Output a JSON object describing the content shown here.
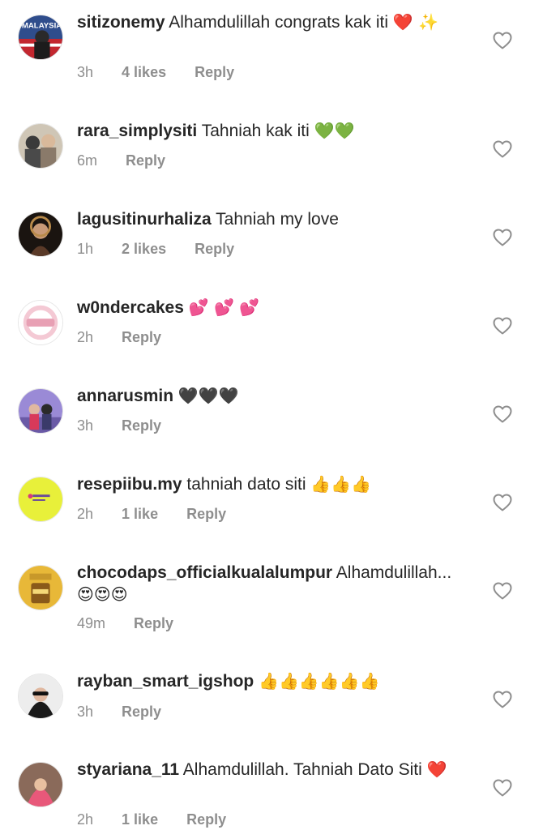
{
  "comments": [
    {
      "username": "sitizonemy",
      "text": "Alhamdulillah congrats kak iti",
      "emoji": "❤️ ✨",
      "time": "3h",
      "likes": "4 likes",
      "reply": "Reply"
    },
    {
      "username": "rara_simplysiti",
      "text": "Tahniah kak iti",
      "emoji": "💚💚",
      "time": "6m",
      "likes": "",
      "reply": "Reply"
    },
    {
      "username": "lagusitinurhaliza",
      "text": "Tahniah my love",
      "emoji": "",
      "time": "1h",
      "likes": "2 likes",
      "reply": "Reply"
    },
    {
      "username": "w0ndercakes",
      "text": "",
      "emoji": "💕 💕 💕",
      "time": "2h",
      "likes": "",
      "reply": "Reply"
    },
    {
      "username": "annarusmin",
      "text": "",
      "emoji": "🖤🖤🖤",
      "time": "3h",
      "likes": "",
      "reply": "Reply"
    },
    {
      "username": "resepiibu.my",
      "text": "tahniah dato siti",
      "emoji": "👍👍👍",
      "time": "2h",
      "likes": "1 like",
      "reply": "Reply"
    },
    {
      "username": "chocodaps_officialkualalumpur",
      "text": "Alhamdulillah...",
      "emoji": "😍😍😍",
      "time": "49m",
      "likes": "",
      "reply": "Reply"
    },
    {
      "username": "rayban_smart_igshop",
      "text": "",
      "emoji": "👍👍👍👍👍👍",
      "time": "3h",
      "likes": "",
      "reply": "Reply"
    },
    {
      "username": "styariana_11",
      "text": "Alhamdulillah. Tahniah Dato Siti",
      "emoji": "❤️",
      "time": "2h",
      "likes": "1 like",
      "reply": "Reply"
    }
  ],
  "icons": {
    "like": "heart-outline-icon"
  },
  "colors": {
    "text": "#262626",
    "meta": "#8e8e8e",
    "heart_outline": "#8e8e8e"
  }
}
